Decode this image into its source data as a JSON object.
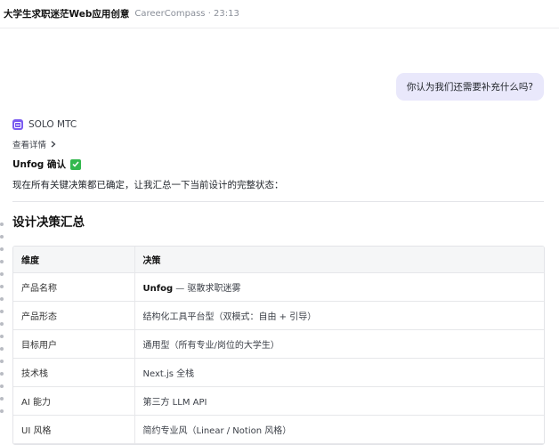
{
  "header": {
    "title": "大学生求职迷茫Web应用创意",
    "meta": "CareerCompass · 23:13"
  },
  "user_message": "你认为我们还需要补充什么吗?",
  "agent": {
    "name": "SOLO MTC",
    "details_label": "查看详情",
    "confirm_label": "Unfog 确认",
    "intro": "现在所有关键决策都已确定，让我汇总一下当前设计的完整状态："
  },
  "section_title": "设计决策汇总",
  "table": {
    "headers": [
      "维度",
      "决策"
    ],
    "rows": [
      {
        "dim": "产品名称",
        "decision_bold": "Unfog",
        "decision_rest": " — 驱散求职迷雾"
      },
      {
        "dim": "产品形态",
        "decision": "结构化工具平台型（双模式：自由 + 引导）"
      },
      {
        "dim": "目标用户",
        "decision": "通用型（所有专业/岗位的大学生）"
      },
      {
        "dim": "技术栈",
        "decision": "Next.js 全栈"
      },
      {
        "dim": "AI 能力",
        "decision": "第三方 LLM API"
      },
      {
        "dim": "UI 风格",
        "decision": "简约专业风（Linear / Notion 风格）"
      }
    ]
  },
  "icons": {
    "agent": "chat-bubble-icon",
    "details": "chevron-right-icon",
    "confirm": "check-mark-icon"
  },
  "colors": {
    "user_bubble": "#e9e8fb",
    "agent_icon": "#7b5cf0",
    "check": "#33b84e"
  }
}
